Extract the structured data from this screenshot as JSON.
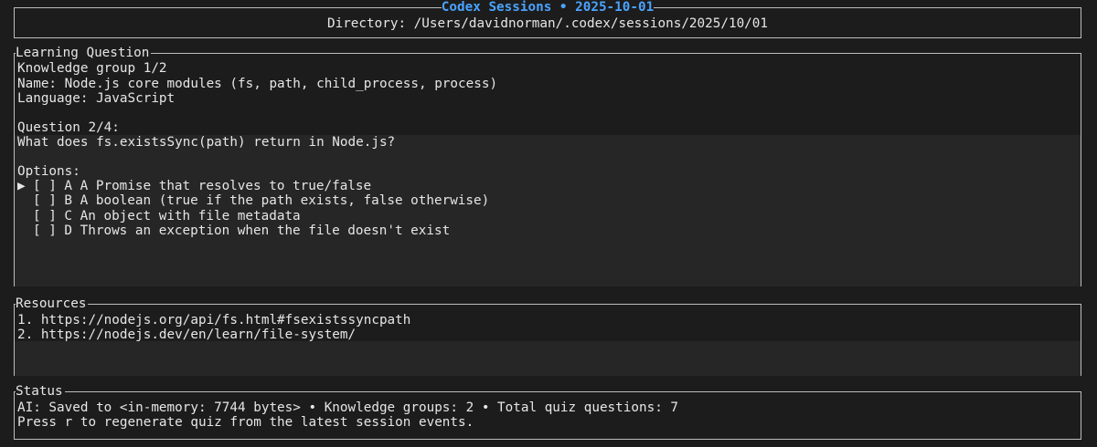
{
  "header": {
    "title": "Codex Sessions • 2025-10-01",
    "directory_label": "Directory: /Users/davidnorman/.codex/sessions/2025/10/01"
  },
  "question_panel": {
    "title": "Learning Question",
    "knowledge_group": "Knowledge group 1/2",
    "name": "Name: Node.js core modules (fs, path, child_process, process)",
    "language": "Language: JavaScript",
    "question_number": "Question 2/4:",
    "question_text": "What does fs.existsSync(path) return in Node.js?",
    "options_label": "Options:",
    "cursor": "▶",
    "options": [
      "[ ] A A Promise that resolves to true/false",
      "[ ] B A boolean (true if the path exists, false otherwise)",
      "[ ] C An object with file metadata",
      "[ ] D Throws an exception when the file doesn't exist"
    ]
  },
  "resources_panel": {
    "title": "Resources",
    "items": [
      "1. https://nodejs.org/api/fs.html#fsexistssyncpath",
      "2. https://nodejs.dev/en/learn/file-system/"
    ]
  },
  "status_panel": {
    "title": "Status",
    "ai_line": "AI: Saved to <in-memory: 7744 bytes> • Knowledge groups: 2 • Total quiz questions: 7",
    "hint_line": "Press r to regenerate quiz from the latest session events."
  },
  "colors": {
    "title_accent": "#4aa3ff",
    "border": "#bdbdbd",
    "background": "#1c1c1c"
  }
}
